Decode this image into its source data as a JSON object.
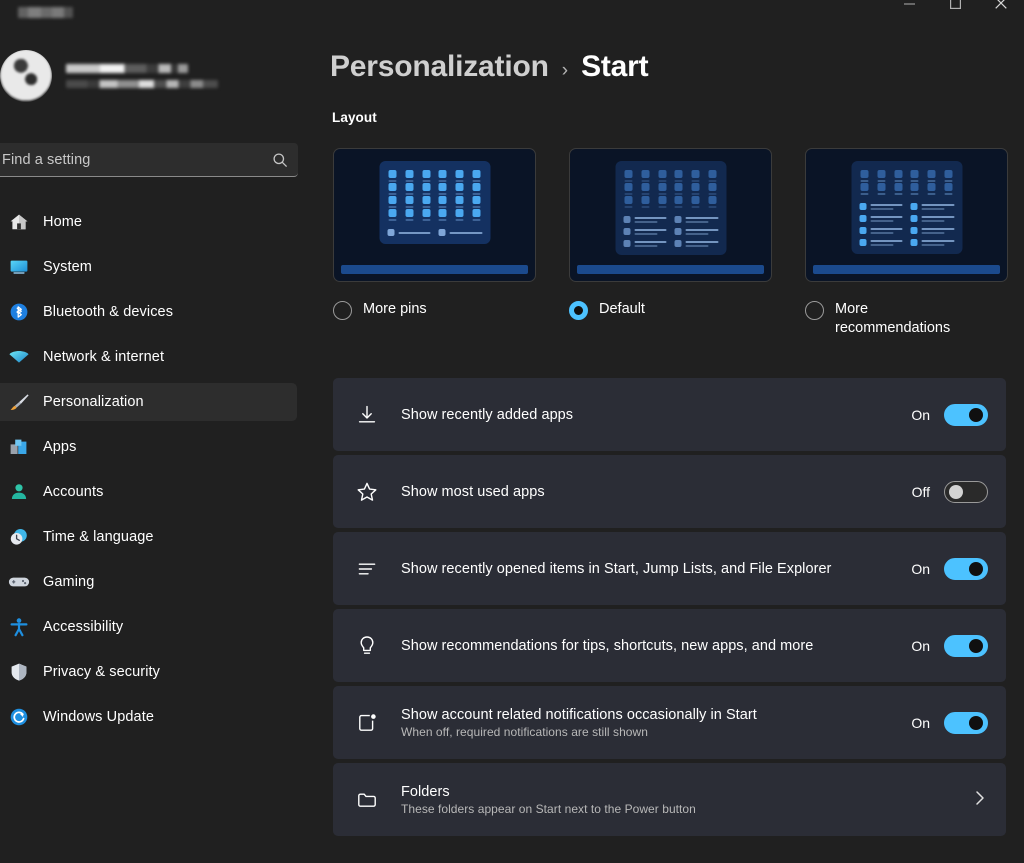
{
  "window": {
    "controls": [
      {
        "name": "minimize",
        "label": "Minimize"
      },
      {
        "name": "maximize",
        "label": "Maximize"
      },
      {
        "name": "close",
        "label": "Close"
      }
    ]
  },
  "sidebar": {
    "search": {
      "placeholder": "Find a setting",
      "value": "",
      "icon": "search-icon"
    },
    "items": [
      {
        "label": "Home",
        "icon": "home-icon",
        "selected": false
      },
      {
        "label": "System",
        "icon": "system-icon",
        "selected": false
      },
      {
        "label": "Bluetooth & devices",
        "icon": "bluetooth-icon",
        "selected": false
      },
      {
        "label": "Network & internet",
        "icon": "wifi-icon",
        "selected": false
      },
      {
        "label": "Personalization",
        "icon": "paintbrush-icon",
        "selected": true
      },
      {
        "label": "Apps",
        "icon": "apps-icon",
        "selected": false
      },
      {
        "label": "Accounts",
        "icon": "person-icon",
        "selected": false
      },
      {
        "label": "Time & language",
        "icon": "clock-icon",
        "selected": false
      },
      {
        "label": "Gaming",
        "icon": "gamepad-icon",
        "selected": false
      },
      {
        "label": "Accessibility",
        "icon": "accessibility-icon",
        "selected": false
      },
      {
        "label": "Privacy & security",
        "icon": "shield-icon",
        "selected": false
      },
      {
        "label": "Windows Update",
        "icon": "update-icon",
        "selected": false
      }
    ]
  },
  "header": {
    "breadcrumb_parent": "Personalization",
    "breadcrumb_separator": "›",
    "breadcrumb_current": "Start"
  },
  "layout_section": {
    "title": "Layout",
    "options": [
      {
        "label": "More pins",
        "selected": false,
        "pin_rows": 4,
        "pin_cols": 6,
        "rec_rows": 1,
        "rec_cols": 2,
        "style": "bright-pins"
      },
      {
        "label": "Default",
        "selected": true,
        "pin_rows": 3,
        "pin_cols": 6,
        "rec_rows": 3,
        "rec_cols": 2,
        "style": "dim"
      },
      {
        "label": "More recommendations",
        "selected": false,
        "pin_rows": 2,
        "pin_cols": 6,
        "rec_rows": 4,
        "rec_cols": 2,
        "style": "bright-recs"
      }
    ]
  },
  "settings": [
    {
      "title": "Show recently added apps",
      "subtitle": "",
      "icon": "download-icon",
      "control": "toggle",
      "state_label": "On",
      "state": "on"
    },
    {
      "title": "Show most used apps",
      "subtitle": "",
      "icon": "star-icon",
      "control": "toggle",
      "state_label": "Off",
      "state": "off"
    },
    {
      "title": "Show recently opened items in Start, Jump Lists, and File Explorer",
      "subtitle": "",
      "icon": "list-icon",
      "control": "toggle",
      "state_label": "On",
      "state": "on"
    },
    {
      "title": "Show recommendations for tips, shortcuts, new apps, and more",
      "subtitle": "",
      "icon": "lightbulb-icon",
      "control": "toggle",
      "state_label": "On",
      "state": "on"
    },
    {
      "title": "Show account related notifications occasionally in Start",
      "subtitle": "When off, required notifications are still shown",
      "icon": "notification-badge-icon",
      "control": "toggle",
      "state_label": "On",
      "state": "on"
    },
    {
      "title": "Folders",
      "subtitle": "These folders appear on Start next to the Power button",
      "icon": "folder-icon",
      "control": "chevron",
      "state_label": "",
      "state": ""
    }
  ],
  "colors": {
    "accent": "#4cc2ff",
    "page_bg": "#202020",
    "card_bg": "#2b2d36",
    "selected_nav_bg": "#2d2d2d",
    "preview_bg": "#0a1426"
  }
}
